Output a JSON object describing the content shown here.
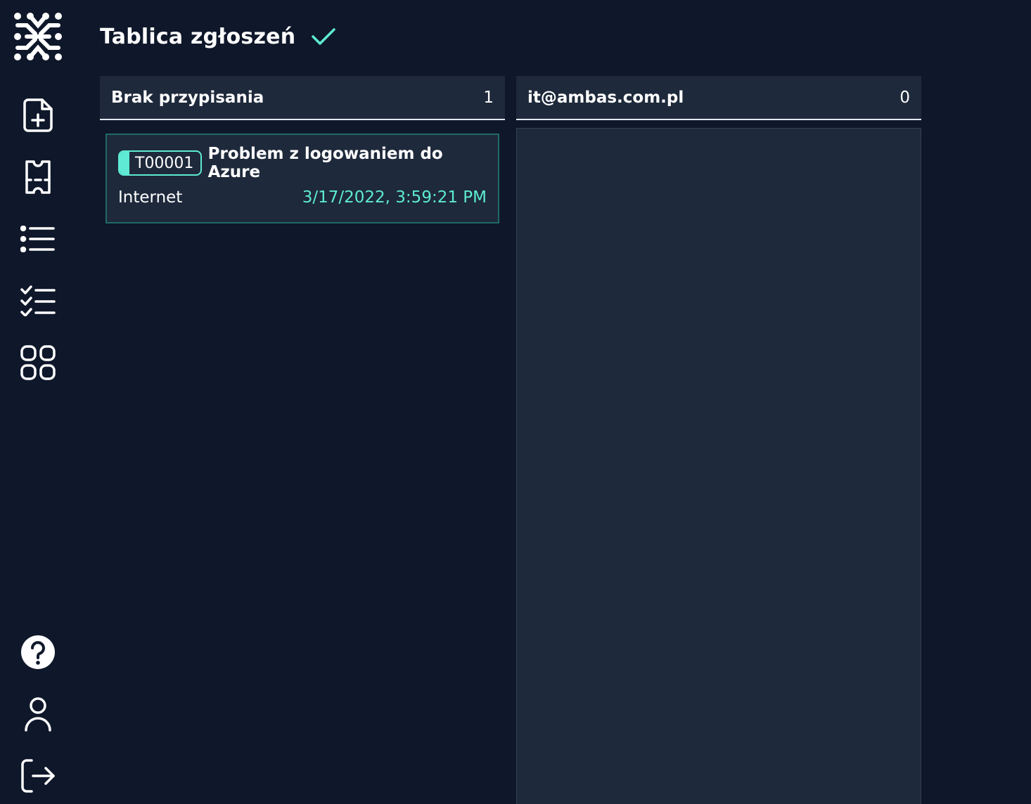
{
  "header": {
    "title": "Tablica zgłoszeń"
  },
  "sidebar": {
    "top_items": [
      "logo-icon",
      "new-document-icon",
      "ticket-icon",
      "list-icon",
      "checklist-icon",
      "apps-grid-icon"
    ],
    "bottom_items": [
      "help-icon",
      "user-icon",
      "logout-icon"
    ]
  },
  "columns": [
    {
      "title": "Brak przypisania",
      "count": "1",
      "tickets": [
        {
          "id": "T00001",
          "title": "Problem z logowaniem do Azure",
          "category": "Internet",
          "date": "3/17/2022, 3:59:21 PM"
        }
      ]
    },
    {
      "title": "it@ambas.com.pl",
      "count": "0",
      "tickets": []
    }
  ],
  "colors": {
    "background": "#0f172a",
    "panel": "#1e293b",
    "accent": "#5eead4",
    "card_border": "#1f6b63"
  }
}
